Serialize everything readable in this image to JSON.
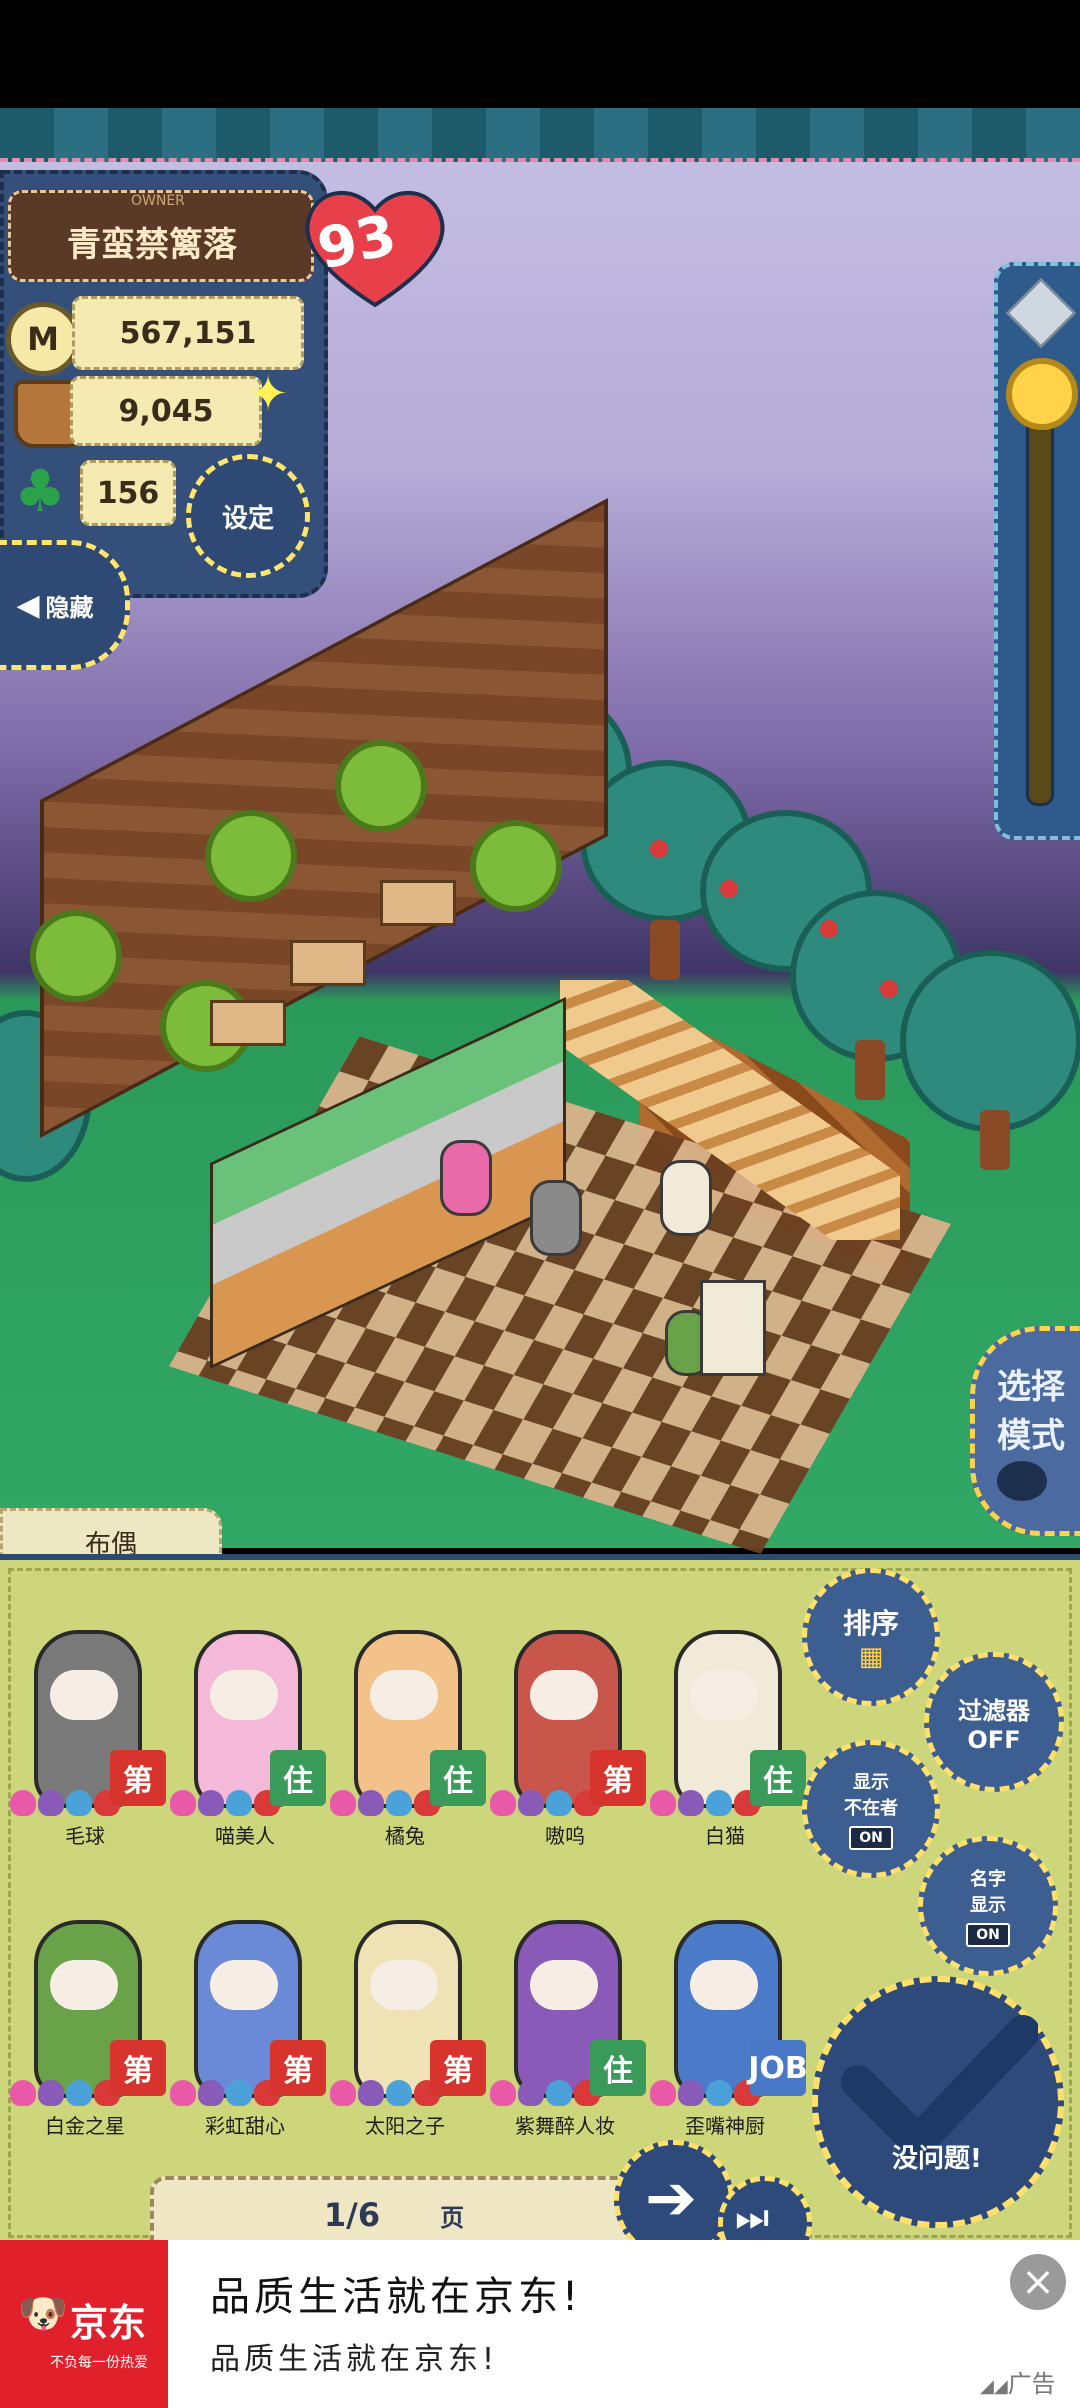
{
  "hud": {
    "owner_caption": "OWNER",
    "village_name": "青蛮禁篱落",
    "heart_value": "93",
    "money": "567,151",
    "money_icon_letter": "M",
    "harvest": "9,045",
    "clover": "156",
    "settings_label": "设定",
    "hide_label": "隐藏"
  },
  "scene": {
    "select_mode_label_1": "选择",
    "select_mode_label_2": "模式"
  },
  "panel": {
    "tab_label": "布偶",
    "sort_label": "排序",
    "filter_label_1": "过滤器",
    "filter_label_2": "OFF",
    "show_absent_label_1": "显示",
    "show_absent_label_2": "不在者",
    "show_absent_toggle": "ON",
    "show_name_label_1": "名字",
    "show_name_label_2": "显示",
    "show_name_toggle": "ON",
    "confirm_label": "没问题!",
    "page_current": "1/6",
    "page_unit": "页"
  },
  "dolls": [
    {
      "name": "毛球",
      "badge": "第",
      "badge_color": "#d8342e",
      "body_color": "#7a7a7a"
    },
    {
      "name": "喵美人",
      "badge": "住",
      "badge_color": "#3a9a5a",
      "body_color": "#f4b8d8"
    },
    {
      "name": "橘兔",
      "badge": "住",
      "badge_color": "#3a9a5a",
      "body_color": "#f2c28a"
    },
    {
      "name": "嗷呜",
      "badge": "第",
      "badge_color": "#d8342e",
      "body_color": "#c8564a"
    },
    {
      "name": "白猫",
      "badge": "住",
      "badge_color": "#3a9a5a",
      "body_color": "#f2ead8"
    },
    {
      "name": "白金之星",
      "badge": "第",
      "badge_color": "#d8342e",
      "body_color": "#6aa24a"
    },
    {
      "name": "彩虹甜心",
      "badge": "第",
      "badge_color": "#d8342e",
      "body_color": "#6a8ad8"
    },
    {
      "name": "太阳之子",
      "badge": "第",
      "badge_color": "#d8342e",
      "body_color": "#efe2b4"
    },
    {
      "name": "紫舞醉人妆",
      "badge": "住",
      "badge_color": "#3a9a5a",
      "body_color": "#8a5ab8"
    },
    {
      "name": "歪嘴神厨",
      "badge": "JOB",
      "badge_color": "#4a78c8",
      "body_color": "#4a7ac8"
    }
  ],
  "ad": {
    "brand": "京东",
    "brand_slogan": "不负每一份热爱",
    "headline": "品质生活就在京东!",
    "subline": "品质生活就在京东!",
    "ad_tag": "广告"
  },
  "colors": {
    "panel_green": "#cdd67a",
    "button_blue": "#2d4a7a",
    "accent_yellow": "#ffe06a",
    "ad_red": "#e0202a"
  }
}
